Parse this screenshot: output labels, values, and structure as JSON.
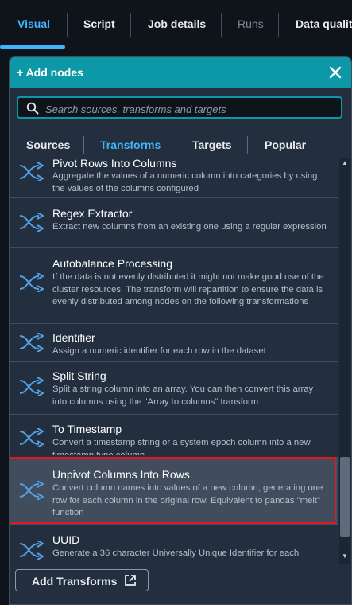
{
  "top_tabs": [
    {
      "label": "Visual",
      "state": "active"
    },
    {
      "label": "Script",
      "state": "normal"
    },
    {
      "label": "Job details",
      "state": "normal"
    },
    {
      "label": "Runs",
      "state": "disabled"
    },
    {
      "label": "Data qualit",
      "state": "normal"
    }
  ],
  "panel": {
    "title": "+ Add nodes",
    "search_placeholder": "Search sources, transforms and targets",
    "sub_tabs": [
      "Sources",
      "Transforms",
      "Targets",
      "Popular"
    ],
    "active_sub_tab": "Transforms",
    "items": [
      {
        "title": "Pivot Rows Into Columns",
        "desc": "Aggregate the values of a numeric column into categories by using the values of the columns configured"
      },
      {
        "title": "Regex Extractor",
        "desc": "Extract new columns from an existing one using a regular expression"
      },
      {
        "title": "Autobalance Processing",
        "desc": "If the data is not evenly distributed it might not make good use of the cluster resources. The transform will repartition to ensure the data is evenly distributed among nodes on the following transformations"
      },
      {
        "title": "Identifier",
        "desc": "Assign a numeric identifier for each row in the dataset"
      },
      {
        "title": "Split String",
        "desc": "Split a string column into an array. You can then convert this array into columns using the \"Array to columns\" transform"
      },
      {
        "title": "To Timestamp",
        "desc": "Convert a timestamp string or a system epoch column into a new timestamp type column"
      },
      {
        "title": "Unpivot Columns Into Rows",
        "desc": "Convert column names into values of a new column, generating one row for each column in the original row. Equivalent to pandas \"melt\" function",
        "highlighted": true
      },
      {
        "title": "UUID",
        "desc": "Generate a 36 character Universally Unique Identifier for each"
      }
    ],
    "add_button_label": "Add Transforms"
  },
  "colors": {
    "accent": "#42b4ff",
    "header": "#0d98a7",
    "highlight_border": "#e4161e",
    "panel_bg": "#232f3e"
  },
  "icons": {
    "item": "transform-shuffle-icon",
    "close": "close-icon",
    "search": "search-icon",
    "external": "external-link-icon"
  }
}
